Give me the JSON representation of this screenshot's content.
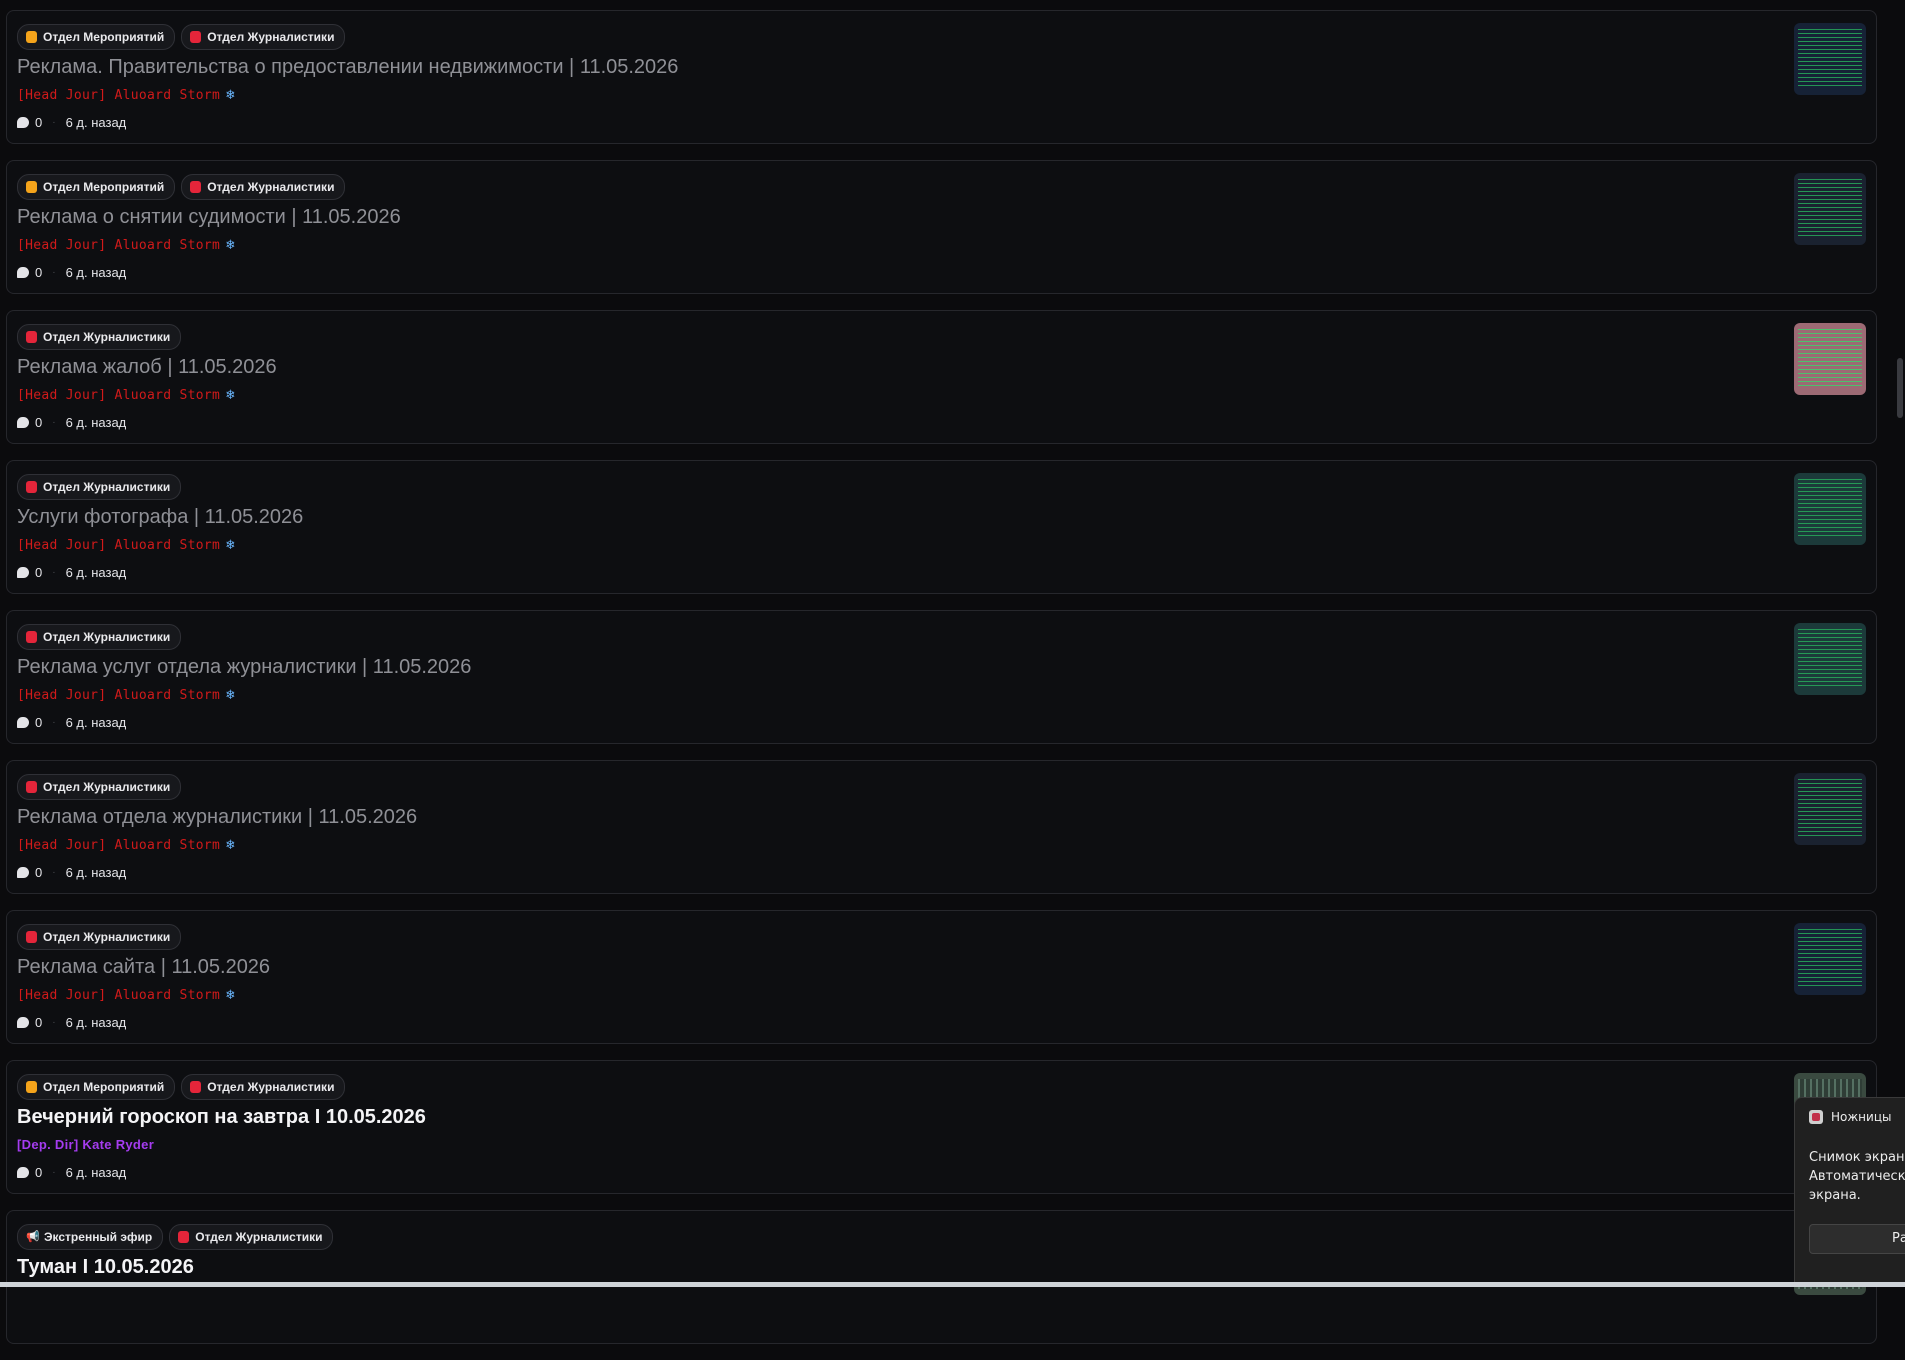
{
  "posts": [
    {
      "tags": [
        {
          "label": "Отдел Мероприятий",
          "icon": "orange"
        },
        {
          "label": "Отдел Журналистики",
          "icon": "red"
        }
      ],
      "title": "Реклама. Правительства о предоставлении недвижимости | 11.05.2026",
      "author": "[Head Jour] Aluoard Storm",
      "author_style": "red",
      "comments": "0",
      "time": "6 д. назад",
      "thumb": "navy",
      "highlight": false
    },
    {
      "tags": [
        {
          "label": "Отдел Мероприятий",
          "icon": "orange"
        },
        {
          "label": "Отдел Журналистики",
          "icon": "red"
        }
      ],
      "title": "Реклама о снятии судимости | 11.05.2026",
      "author": "[Head Jour] Aluoard Storm",
      "author_style": "red",
      "comments": "0",
      "time": "6 д. назад",
      "thumb": "dark",
      "highlight": false
    },
    {
      "tags": [
        {
          "label": "Отдел Журналистики",
          "icon": "red"
        }
      ],
      "title": "Реклама жалоб | 11.05.2026",
      "author": "[Head Jour] Aluoard Storm",
      "author_style": "red",
      "comments": "0",
      "time": "6 д. назад",
      "thumb": "pink",
      "highlight": false
    },
    {
      "tags": [
        {
          "label": "Отдел Журналистики",
          "icon": "red"
        }
      ],
      "title": "Услуги фотографа | 11.05.2026",
      "author": "[Head Jour] Aluoard Storm",
      "author_style": "red",
      "comments": "0",
      "time": "6 д. назад",
      "thumb": "teal",
      "highlight": false
    },
    {
      "tags": [
        {
          "label": "Отдел Журналистики",
          "icon": "red"
        }
      ],
      "title": "Реклама услуг отдела журналистики | 11.05.2026",
      "author": "[Head Jour] Aluoard Storm",
      "author_style": "red",
      "comments": "0",
      "time": "6 д. назад",
      "thumb": "teal",
      "highlight": false
    },
    {
      "tags": [
        {
          "label": "Отдел Журналистики",
          "icon": "red"
        }
      ],
      "title": "Реклама отдела журналистики | 11.05.2026",
      "author": "[Head Jour] Aluoard Storm",
      "author_style": "red",
      "comments": "0",
      "time": "6 д. назад",
      "thumb": "dark",
      "highlight": false
    },
    {
      "tags": [
        {
          "label": "Отдел Журналистики",
          "icon": "red"
        }
      ],
      "title": "Реклама сайта | 11.05.2026",
      "author": "[Head Jour] Aluoard Storm",
      "author_style": "red",
      "comments": "0",
      "time": "6 д. назад",
      "thumb": "navy",
      "highlight": false
    },
    {
      "tags": [
        {
          "label": "Отдел Мероприятий",
          "icon": "orange"
        },
        {
          "label": "Отдел Журналистики",
          "icon": "red"
        }
      ],
      "title": "Вечерний гороскоп на завтра I 10.05.2026",
      "author": "[Dep. Dir] Kate Ryder",
      "author_style": "purple",
      "comments": "0",
      "time": "6 д. назад",
      "thumb": "photo",
      "highlight": true
    },
    {
      "tags": [
        {
          "label": "Экстренный эфир",
          "icon": "mega"
        },
        {
          "label": "Отдел Журналистики",
          "icon": "red"
        }
      ],
      "title": "Туман I 10.05.2026",
      "author": "",
      "author_style": "red",
      "comments": "",
      "time": "",
      "thumb": "photo",
      "highlight": true
    }
  ],
  "toast": {
    "app_name": "Ножницы",
    "line1": "Снимок экрана",
    "line2": "Автоматически",
    "line3": "экрана.",
    "button": "Ра"
  },
  "colors": {
    "background": "#0b0b0d",
    "author_red": "#d11a1a",
    "author_purple": "#a53cf0",
    "tag_orange": "#f5a41b",
    "tag_red": "#e4253a"
  }
}
